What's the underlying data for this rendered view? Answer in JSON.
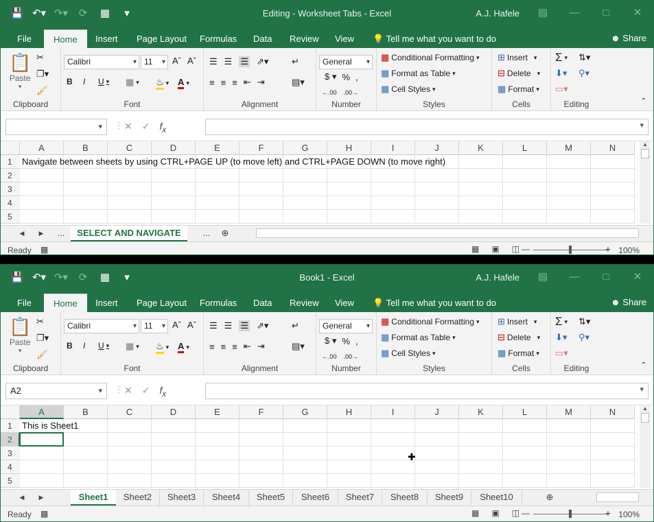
{
  "windows": [
    {
      "title": "Editing - Worksheet Tabs  -  Excel",
      "user": "A.J. Hafele",
      "tabs": [
        "File",
        "Home",
        "Insert",
        "Page Layout",
        "Formulas",
        "Data",
        "Review",
        "View"
      ],
      "tell_me": "Tell me what you want to do",
      "share": "Share",
      "font_name": "Calibri",
      "font_size": "11",
      "number_format": "General",
      "paste": "Paste",
      "groups": {
        "clipboard": "Clipboard",
        "font": "Font",
        "alignment": "Alignment",
        "number": "Number",
        "styles": "Styles",
        "cells": "Cells",
        "editing": "Editing"
      },
      "styles": {
        "cond": "Conditional Formatting",
        "table": "Format as Table",
        "cell": "Cell Styles"
      },
      "cells": {
        "insert": "Insert",
        "delete": "Delete",
        "format": "Format"
      },
      "name_box": "",
      "columns": [
        "A",
        "B",
        "C",
        "D",
        "E",
        "F",
        "G",
        "H",
        "I",
        "J",
        "K",
        "L",
        "M",
        "N"
      ],
      "rows": [
        "1",
        "2",
        "3",
        "4",
        "5"
      ],
      "cell_a1": "Navigate between sheets by using CTRL+PAGE UP (to move left) and CTRL+PAGE DOWN (to move right)",
      "sheet_tabs": [
        "SELECT AND NAVIGATE"
      ],
      "ellipsis": "...",
      "status": "Ready",
      "zoom": "100%"
    },
    {
      "title": "Book1  -  Excel",
      "user": "A.J. Hafele",
      "tabs": [
        "File",
        "Home",
        "Insert",
        "Page Layout",
        "Formulas",
        "Data",
        "Review",
        "View"
      ],
      "tell_me": "Tell me what you want to do",
      "share": "Share",
      "font_name": "Calibri",
      "font_size": "11",
      "number_format": "General",
      "paste": "Paste",
      "groups": {
        "clipboard": "Clipboard",
        "font": "Font",
        "alignment": "Alignment",
        "number": "Number",
        "styles": "Styles",
        "cells": "Cells",
        "editing": "Editing"
      },
      "styles": {
        "cond": "Conditional Formatting",
        "table": "Format as Table",
        "cell": "Cell Styles"
      },
      "cells": {
        "insert": "Insert",
        "delete": "Delete",
        "format": "Format"
      },
      "name_box": "A2",
      "columns": [
        "A",
        "B",
        "C",
        "D",
        "E",
        "F",
        "G",
        "H",
        "I",
        "J",
        "K",
        "L",
        "M",
        "N"
      ],
      "rows": [
        "1",
        "2",
        "3",
        "4",
        "5"
      ],
      "cell_a1": "This is Sheet1",
      "sheet_tabs": [
        "Sheet1",
        "Sheet2",
        "Sheet3",
        "Sheet4",
        "Sheet5",
        "Sheet6",
        "Sheet7",
        "Sheet8",
        "Sheet9",
        "Sheet10"
      ],
      "status": "Ready",
      "zoom": "100%"
    }
  ],
  "colors": {
    "accent": "#217346",
    "ribbon": "#f3f3f3"
  }
}
